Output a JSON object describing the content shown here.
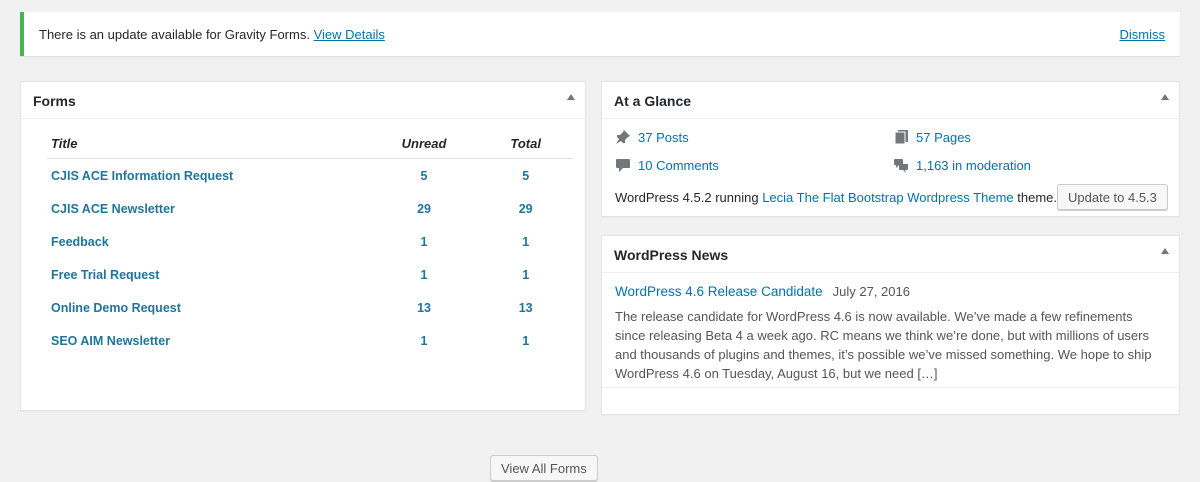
{
  "notice": {
    "message": "There is an update available for Gravity Forms.",
    "link": "View Details",
    "dismiss": "Dismiss",
    "accent_color": "#46b450"
  },
  "forms_widget": {
    "title": "Forms",
    "columns": [
      "Title",
      "Unread",
      "Total"
    ],
    "rows": [
      {
        "title": "CJIS ACE Information Request",
        "unread": "5",
        "total": "5"
      },
      {
        "title": "CJIS ACE Newsletter",
        "unread": "29",
        "total": "29"
      },
      {
        "title": "Feedback",
        "unread": "1",
        "total": "1"
      },
      {
        "title": "Free Trial Request",
        "unread": "1",
        "total": "1"
      },
      {
        "title": "Online Demo Request",
        "unread": "13",
        "total": "13"
      },
      {
        "title": "SEO AIM Newsletter",
        "unread": "1",
        "total": "1"
      }
    ],
    "view_all_label": "View All Forms"
  },
  "glance_widget": {
    "title": "At a Glance",
    "posts": "37 Posts",
    "pages": "57 Pages",
    "comments": "10 Comments",
    "moderation": "1,163 in moderation",
    "footer_prefix": "WordPress 4.5.2 running",
    "theme_name": "Lecia The Flat Bootstrap Wordpress Theme",
    "footer_suffix": "theme.",
    "update_label": "Update to 4.5.3"
  },
  "news_widget": {
    "title": "WordPress News",
    "item": {
      "title": "WordPress 4.6 Release Candidate",
      "date": "July 27, 2016",
      "excerpt": "The release candidate for WordPress 4.6 is now available. We’ve made a few refinements since releasing Beta 4 a week ago. RC means we think we’re done, but with millions of users and thousands of plugins and themes, it’s possible we’ve missed something. We hope to ship WordPress 4.6 on Tuesday, August 16, but we need […]"
    }
  },
  "icons": {
    "posts": "pushpin-icon",
    "pages": "pages-icon",
    "comments": "comment-icon",
    "moderation": "comments-moderation-icon",
    "toggle": "collapse-arrow-icon"
  },
  "colors": {
    "link": "#0073aa",
    "background": "#f1f1f1"
  }
}
